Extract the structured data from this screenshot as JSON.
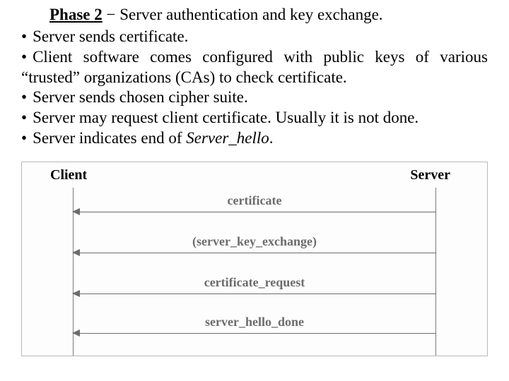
{
  "heading": {
    "phase_label": "Phase 2",
    "dash": " − ",
    "title": "Server authentication and key exchange."
  },
  "bullets": {
    "items": [
      {
        "text": "Server sends certificate."
      },
      {
        "text": "Client software comes configured with public keys of various “trusted” organizations (CAs) to check certificate."
      },
      {
        "text": "Server sends chosen cipher suite."
      },
      {
        "text": "Server may request client certificate. Usually it is not done."
      },
      {
        "text_prefix": "Server indicates end of ",
        "text_italic": "Server_hello",
        "text_suffix": "."
      }
    ]
  },
  "diagram": {
    "participants": {
      "left": "Client",
      "right": "Server"
    },
    "messages": [
      {
        "label": "certificate"
      },
      {
        "label": "(server_key_exchange)"
      },
      {
        "label": "certificate_request"
      },
      {
        "label": "server_hello_done"
      }
    ]
  }
}
